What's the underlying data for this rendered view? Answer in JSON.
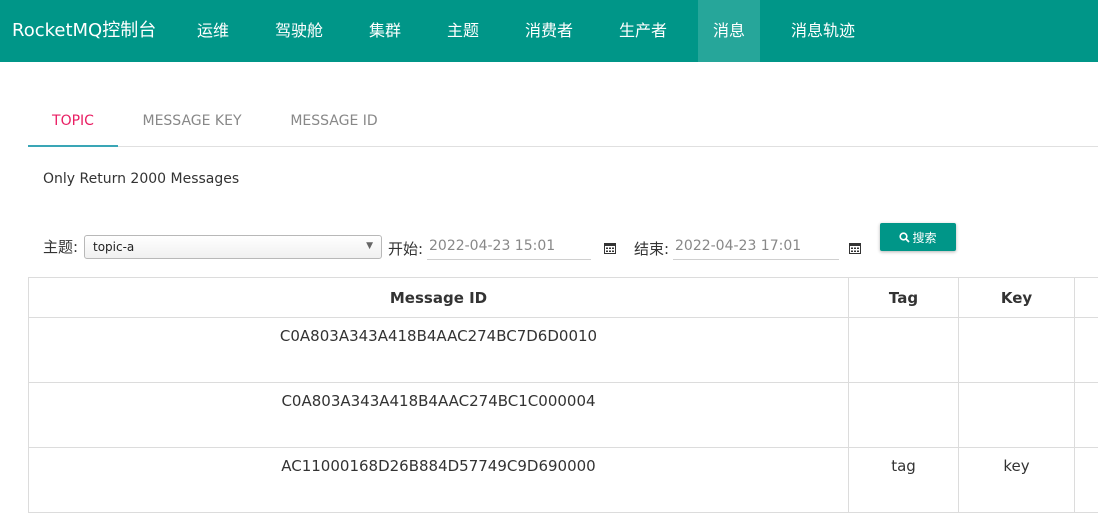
{
  "app": {
    "title": "RocketMQ控制台"
  },
  "nav": {
    "items": [
      {
        "label": "运维"
      },
      {
        "label": "驾驶舱"
      },
      {
        "label": "集群"
      },
      {
        "label": "主题"
      },
      {
        "label": "消费者"
      },
      {
        "label": "生产者"
      },
      {
        "label": "消息"
      },
      {
        "label": "消息轨迹"
      }
    ],
    "active": "消息"
  },
  "tabs": [
    {
      "label": "TOPIC"
    },
    {
      "label": "MESSAGE KEY"
    },
    {
      "label": "MESSAGE ID"
    }
  ],
  "active_tab": "TOPIC",
  "note": "Only Return 2000 Messages",
  "filter": {
    "topic_label": "主题:",
    "topic_value": "topic-a",
    "start_label": "开始:",
    "start_value": "2022-04-23 15:01",
    "end_label": "结束:",
    "end_value": "2022-04-23 17:01",
    "search_label": "搜索",
    "search_icon": "search-icon",
    "calendar_icon": "calendar-icon"
  },
  "table": {
    "headers": [
      "Message ID",
      "Tag",
      "Key"
    ],
    "rows": [
      {
        "id": "C0A803A343A418B4AAC274BC7D6D0010",
        "tag": "",
        "key": ""
      },
      {
        "id": "C0A803A343A418B4AAC274BC1C000004",
        "tag": "",
        "key": ""
      },
      {
        "id": "AC11000168D26B884D57749C9D690000",
        "tag": "tag",
        "key": "key"
      }
    ]
  },
  "colors": {
    "primary": "#009688",
    "active_tab_text": "#e91e63",
    "tab_indicator": "#3aa6b6"
  }
}
